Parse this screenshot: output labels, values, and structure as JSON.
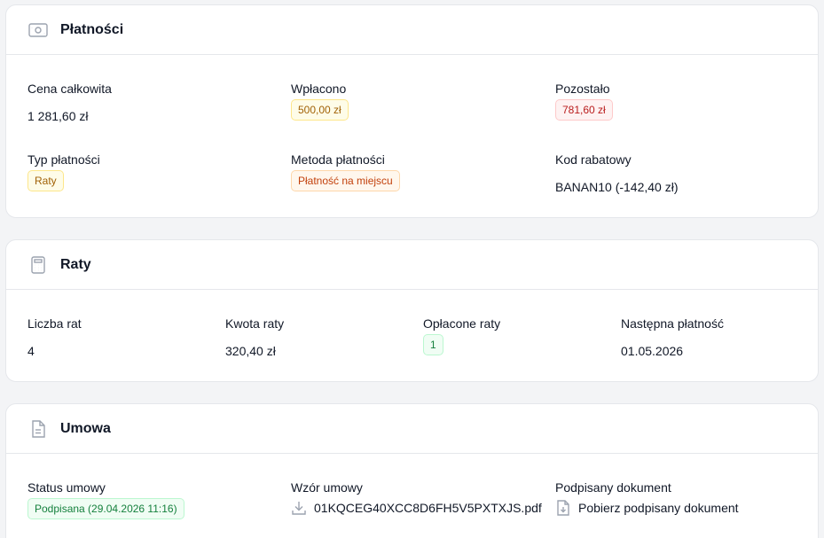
{
  "payments": {
    "title": "Płatności",
    "fields": {
      "total_price": {
        "label": "Cena całkowita",
        "value": "1 281,60 zł"
      },
      "paid": {
        "label": "Wpłacono",
        "value": "500,00 zł"
      },
      "remaining": {
        "label": "Pozostało",
        "value": "781,60 zł"
      },
      "payment_type": {
        "label": "Typ płatności",
        "value": "Raty"
      },
      "payment_method": {
        "label": "Metoda płatności",
        "value": "Płatność na miejscu"
      },
      "discount_code": {
        "label": "Kod rabatowy",
        "value": "BANAN10 (-142,40 zł)"
      }
    }
  },
  "installments": {
    "title": "Raty",
    "fields": {
      "count": {
        "label": "Liczba rat",
        "value": "4"
      },
      "amount": {
        "label": "Kwota raty",
        "value": "320,40 zł"
      },
      "paid_installments": {
        "label": "Opłacone raty",
        "value": "1"
      },
      "next_payment": {
        "label": "Następna płatność",
        "value": "01.05.2026"
      }
    }
  },
  "contract": {
    "title": "Umowa",
    "fields": {
      "status": {
        "label": "Status umowy",
        "value": "Podpisana (29.04.2026 11:16)"
      },
      "template": {
        "label": "Wzór umowy",
        "file": "01KQCEG40XCC8D6FH5V5PXTXJS.pdf"
      },
      "signed": {
        "label": "Podpisany dokument",
        "link": "Pobierz podpisany dokument"
      }
    }
  },
  "icons": {
    "payments": "money-icon",
    "installments": "calculator-icon",
    "contract": "document-icon",
    "template_download": "download-icon",
    "signed_download": "file-download-icon"
  },
  "colors": {
    "yellow_badge": "#a16207",
    "red_badge": "#b91c1c",
    "orange_badge": "#c2410c",
    "green_badge": "#15803d"
  }
}
